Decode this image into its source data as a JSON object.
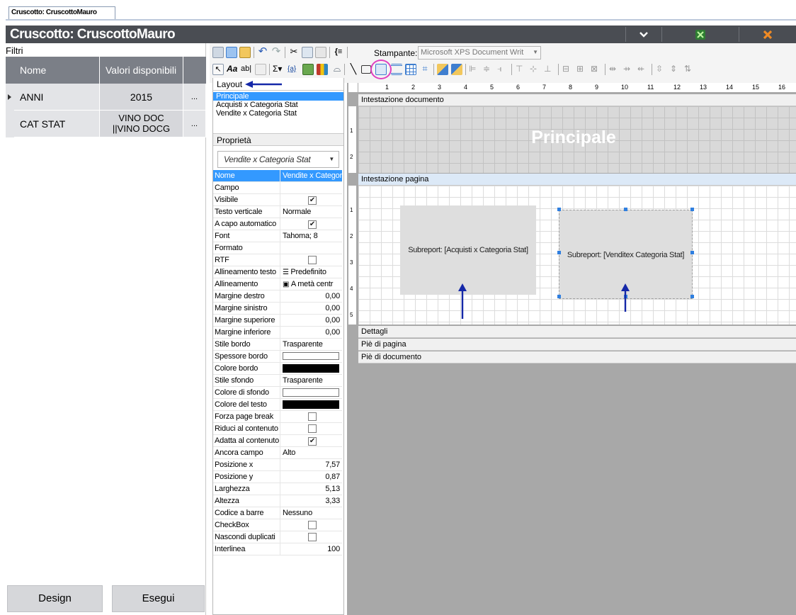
{
  "tab": {
    "title": "Cruscotto: CruscottoMauro"
  },
  "app": {
    "title": "Cruscotto: CruscottoMauro",
    "buttons": [
      "v",
      "X",
      "X"
    ]
  },
  "filters": {
    "label": "Filtri",
    "headers": [
      "Nome",
      "Valori disponibili"
    ],
    "rows": [
      {
        "name": "ANNI",
        "value": "2015",
        "more": "..."
      },
      {
        "name": "CAT STAT",
        "value_line1": "VINO DOC",
        "value_line2": "||VINO DOCG",
        "more": "..."
      }
    ]
  },
  "buttons": {
    "design": "Design",
    "esegui": "Esegui"
  },
  "toolbar": {
    "stampante_label": "Stampante:",
    "stampante_value": "Microsoft XPS Document Writ"
  },
  "layout": {
    "header": "Layout",
    "items": [
      "Principale",
      "Acquisti x Categoria Stat",
      "Vendite x Categoria Stat"
    ]
  },
  "properties": {
    "header": "Proprietà",
    "selected": "Vendite x Categoria Stat",
    "rows": [
      {
        "name": "Nome",
        "value": "Vendite x Categor"
      },
      {
        "name": "Campo",
        "value": ""
      },
      {
        "name": "Visibile",
        "value": "✔"
      },
      {
        "name": "Testo verticale",
        "value": "Normale"
      },
      {
        "name": "A capo automatico",
        "value": "✔"
      },
      {
        "name": "Font",
        "value": "Tahoma; 8"
      },
      {
        "name": "Formato",
        "value": ""
      },
      {
        "name": "RTF",
        "value": ""
      },
      {
        "name": "Allineamento testo",
        "value": "Predefinito"
      },
      {
        "name": "Allineamento",
        "value": "A metà centr"
      },
      {
        "name": "Margine destro",
        "value": "0,00"
      },
      {
        "name": "Margine sinistro",
        "value": "0,00"
      },
      {
        "name": "Margine superiore",
        "value": "0,00"
      },
      {
        "name": "Margine inferiore",
        "value": "0,00"
      },
      {
        "name": "Stile bordo",
        "value": "Trasparente"
      },
      {
        "name": "Spessore bordo",
        "value": ""
      },
      {
        "name": "Colore bordo",
        "value": ""
      },
      {
        "name": "Stile sfondo",
        "value": "Trasparente"
      },
      {
        "name": "Colore di sfondo",
        "value": ""
      },
      {
        "name": "Colore del testo",
        "value": ""
      },
      {
        "name": "Forza page break",
        "value": ""
      },
      {
        "name": "Riduci al contenuto",
        "value": ""
      },
      {
        "name": "Adatta al contenuto",
        "value": "✔"
      },
      {
        "name": "Ancora campo",
        "value": "Alto"
      },
      {
        "name": "Posizione x",
        "value": "7,57"
      },
      {
        "name": "Posizione y",
        "value": "0,87"
      },
      {
        "name": "Larghezza",
        "value": "5,13"
      },
      {
        "name": "Altezza",
        "value": "3,33"
      },
      {
        "name": "Codice a barre",
        "value": "Nessuno"
      },
      {
        "name": "CheckBox",
        "value": ""
      },
      {
        "name": "Nascondi duplicati",
        "value": ""
      },
      {
        "name": "Interlinea",
        "value": "100"
      }
    ]
  },
  "designer": {
    "ruler": [
      "1",
      "2",
      "3",
      "4",
      "5",
      "6",
      "7",
      "8",
      "9",
      "10",
      "11",
      "12",
      "13",
      "14",
      "15",
      "16"
    ],
    "vruler1": [
      "1",
      "2"
    ],
    "vruler2": [
      "1",
      "2",
      "3",
      "4",
      "5"
    ],
    "bands": {
      "intestazione_documento": "Intestazione documento",
      "intestazione_pagina": "Intestazione pagina",
      "dettagli": "Dettagli",
      "pie_pagina": "Piè di pagina",
      "pie_documento": "Piè di documento"
    },
    "principale": "Principale",
    "subreport1": "Subreport: [Acquisti x Categoria Stat]",
    "subreport2": "Subreport: [Venditex Categoria Stat]"
  },
  "colors": {
    "titlebar": "#4a4d53",
    "selection": "#3399ff",
    "arrow": "#1528a8",
    "highlight_circle": "#e040c0"
  }
}
